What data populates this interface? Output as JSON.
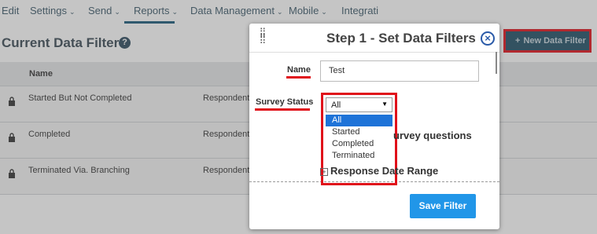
{
  "nav": {
    "items": [
      {
        "label": "Edit",
        "chevron": false
      },
      {
        "label": "Settings",
        "chevron": true
      },
      {
        "label": "Send",
        "chevron": true
      },
      {
        "label": "Reports",
        "chevron": true
      },
      {
        "label": "Data Management",
        "chevron": true
      },
      {
        "label": "Mobile",
        "chevron": true
      },
      {
        "label": "Integrati",
        "chevron": false
      }
    ],
    "active": "Reports"
  },
  "page": {
    "title": "Current Data Filters",
    "help_icon": "?",
    "new_filter_label": "New Data Filter",
    "new_filter_icon": "plus-icon"
  },
  "table": {
    "header_name": "Name",
    "rows": [
      {
        "name": "Started But Not Completed",
        "type": "Respondent"
      },
      {
        "name": "Completed",
        "type": "Respondent"
      },
      {
        "name": "Terminated Via. Branching",
        "type": "Respondent"
      }
    ]
  },
  "modal": {
    "title": "Step 1 - Set Data Filters",
    "close_icon": "×",
    "name_label": "Name",
    "name_value": "Test",
    "status_label": "Survey Status",
    "status_selected": "All",
    "status_options": [
      "All",
      "Started",
      "Completed",
      "Terminated"
    ],
    "survey_questions_text": "urvey questions",
    "response_date_label": "Response Date Range",
    "save_label": "Save Filter"
  },
  "colors": {
    "highlight": "#e0101a",
    "primary_button": "#2196e8",
    "header_button": "#1f4f66",
    "selected_option": "#1e73d8"
  }
}
